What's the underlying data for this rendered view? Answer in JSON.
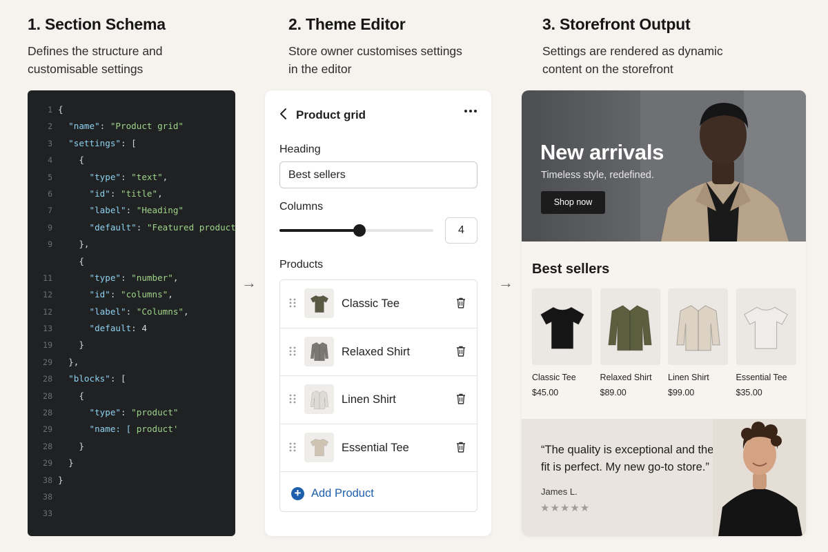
{
  "columns": [
    {
      "title": "1. Section Schema",
      "desc_line1": "Defines the structure and",
      "desc_line2": "customisable settings"
    },
    {
      "title": "2. Theme Editor",
      "desc_line1": "Store owner customises settings",
      "desc_line2": "in the editor"
    },
    {
      "title": "3. Storefront Output",
      "desc_line1": "Settings are rendered as dynamic",
      "desc_line2": "content on the storefront"
    }
  ],
  "code": {
    "line_numbers": [
      "1",
      "2",
      "3",
      "4",
      "5",
      "6",
      "7",
      "9",
      "9",
      "",
      "11",
      "12",
      "12",
      "13",
      "19",
      "29",
      "28",
      "28",
      "28",
      "29",
      "28",
      "29",
      "38",
      "38",
      "33"
    ],
    "lines": [
      [
        {
          "t": "{",
          "c": "n"
        }
      ],
      [
        {
          "t": "  ",
          "c": "n"
        },
        {
          "t": "\"name\"",
          "c": "k"
        },
        {
          "t": ": ",
          "c": "n"
        },
        {
          "t": "\"Product grid\"",
          "c": "s"
        }
      ],
      [
        {
          "t": "  ",
          "c": "n"
        },
        {
          "t": "\"settings\"",
          "c": "k"
        },
        {
          "t": ": [",
          "c": "n"
        }
      ],
      [
        {
          "t": "    {",
          "c": "n"
        }
      ],
      [
        {
          "t": "      ",
          "c": "n"
        },
        {
          "t": "\"type\"",
          "c": "k"
        },
        {
          "t": ": ",
          "c": "n"
        },
        {
          "t": "\"text\"",
          "c": "s"
        },
        {
          "t": ",",
          "c": "n"
        }
      ],
      [
        {
          "t": "      ",
          "c": "n"
        },
        {
          "t": "\"id\"",
          "c": "k"
        },
        {
          "t": ": ",
          "c": "n"
        },
        {
          "t": "\"title\"",
          "c": "s"
        },
        {
          "t": ",",
          "c": "n"
        }
      ],
      [
        {
          "t": "      ",
          "c": "n"
        },
        {
          "t": "\"label\"",
          "c": "k"
        },
        {
          "t": ": ",
          "c": "n"
        },
        {
          "t": "\"Heading\"",
          "c": "s"
        }
      ],
      [
        {
          "t": "      ",
          "c": "n"
        },
        {
          "t": "\"default\"",
          "c": "k"
        },
        {
          "t": ": ",
          "c": "n"
        },
        {
          "t": "\"Featured products\"",
          "c": "s"
        }
      ],
      [
        {
          "t": "    },",
          "c": "n"
        }
      ],
      [
        {
          "t": "    {",
          "c": "n"
        }
      ],
      [
        {
          "t": "      ",
          "c": "n"
        },
        {
          "t": "\"type\"",
          "c": "k"
        },
        {
          "t": ": ",
          "c": "n"
        },
        {
          "t": "\"number\"",
          "c": "s"
        },
        {
          "t": ",",
          "c": "n"
        }
      ],
      [
        {
          "t": "      ",
          "c": "n"
        },
        {
          "t": "\"id\"",
          "c": "k"
        },
        {
          "t": ": ",
          "c": "n"
        },
        {
          "t": "\"columns\"",
          "c": "s"
        },
        {
          "t": ",",
          "c": "n"
        }
      ],
      [
        {
          "t": "      ",
          "c": "n"
        },
        {
          "t": "\"label\"",
          "c": "k"
        },
        {
          "t": ": ",
          "c": "n"
        },
        {
          "t": "\"Columns\"",
          "c": "s"
        },
        {
          "t": ",",
          "c": "n"
        }
      ],
      [
        {
          "t": "      ",
          "c": "n"
        },
        {
          "t": "\"default",
          "c": "k"
        },
        {
          "t": ": 4",
          "c": "n"
        }
      ],
      [
        {
          "t": "    }",
          "c": "n"
        }
      ],
      [
        {
          "t": "  },",
          "c": "n"
        }
      ],
      [
        {
          "t": "  ",
          "c": "n"
        },
        {
          "t": "\"blocks\"",
          "c": "k"
        },
        {
          "t": ": [",
          "c": "n"
        }
      ],
      [
        {
          "t": "    {",
          "c": "n"
        }
      ],
      [
        {
          "t": "      ",
          "c": "n"
        },
        {
          "t": "\"type\"",
          "c": "k"
        },
        {
          "t": ": ",
          "c": "n"
        },
        {
          "t": "\"product\"",
          "c": "s"
        }
      ],
      [
        {
          "t": "      ",
          "c": "n"
        },
        {
          "t": "\"name: [",
          "c": "k"
        },
        {
          "t": " product'",
          "c": "s"
        }
      ],
      [
        {
          "t": "    }",
          "c": "n"
        }
      ],
      [
        {
          "t": "  }",
          "c": "n"
        }
      ],
      [
        {
          "t": "}",
          "c": "n"
        }
      ],
      [
        {
          "t": "",
          "c": "n"
        }
      ],
      [
        {
          "t": "",
          "c": "n"
        }
      ]
    ]
  },
  "editor": {
    "back_icon": "chevron-left-icon",
    "title": "Product grid",
    "more_icon": "more-horizontal-icon",
    "heading_label": "Heading",
    "heading_value": "Best sellers",
    "columns_label": "Columns",
    "columns_value": "4",
    "columns_fraction": 0.52,
    "products_label": "Products",
    "products": [
      {
        "name": "Classic Tee",
        "color": "#5a5a44",
        "kind": "tee"
      },
      {
        "name": "Relaxed Shirt",
        "color": "#7a7872",
        "kind": "shirt"
      },
      {
        "name": "Linen Shirt",
        "color": "#dedbd4",
        "kind": "shirt"
      },
      {
        "name": "Essential Tee",
        "color": "#cfc4b4",
        "kind": "tee"
      }
    ],
    "add_label": "Add Product",
    "accent": "#1d5fad"
  },
  "store": {
    "hero_title": "New arrivals",
    "hero_subtitle": "Timeless style, redefined.",
    "hero_button": "Shop now",
    "section_title": "Best sellers",
    "products": [
      {
        "name": "Classic Tee",
        "price": "$45.00",
        "color": "#151515",
        "kind": "tee"
      },
      {
        "name": "Relaxed Shirt",
        "price": "$89.00",
        "color": "#5b5f3e",
        "kind": "shirt"
      },
      {
        "name": "Linen Shirt",
        "price": "$99.00",
        "color": "#ddd3c4",
        "kind": "shirt"
      },
      {
        "name": "Essential Tee",
        "price": "$35.00",
        "color": "#eeedea",
        "kind": "tee"
      }
    ],
    "quote_line1": "“The quality is exceptional and the",
    "quote_line2": "fit is perfect. My new go-to store.”",
    "author": "James L.",
    "stars": "★★★★★",
    "rating": 5
  }
}
